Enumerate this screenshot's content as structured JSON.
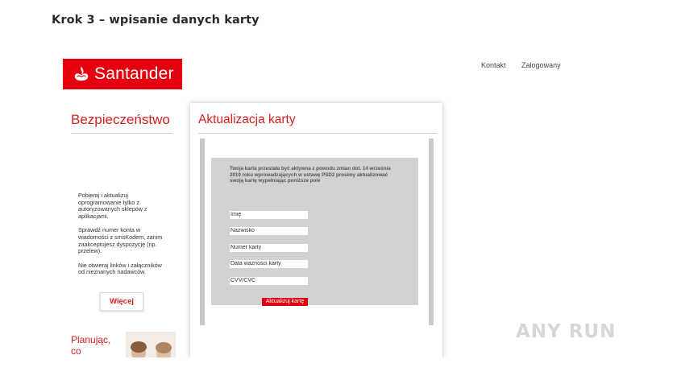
{
  "step_heading": "Krok 3 – wpisanie danych karty",
  "brand": {
    "name": "Santander",
    "color": "#e3000f"
  },
  "top_nav": {
    "contact": "Kontakt",
    "logged_in": "Zalogowany"
  },
  "sidebar": {
    "title": "Bezpieczeństwo",
    "tips": [
      "Pobieraj i aktualizuj oprogramowanie tylko z autoryzowanych sklepów z aplikacjami.",
      "Sprawdź numer konta w wiadomości z smsKodem, zanim zaakceptujesz dyspozycję (np. przelew).",
      "Nie otwieraj linków i załączników od nieznanych nadawców."
    ],
    "more_button": "Więcej",
    "promo_text_line1": "Planując,",
    "promo_text_line2": "co"
  },
  "card_form": {
    "title": "Aktualizacja karty",
    "message": "Twoja karta przestała być aktywna z powodu zmian dot. 14 września 2019 roku wprowadzających w ustawę PSD2 prosimy aktualizować swoją kartę wypełniając poniższe pole",
    "fields": {
      "name": "Imię",
      "surname": "Nazwisko",
      "card_number": "Numer karty",
      "expiry": "Data ważności karty",
      "cvv": "CVV/CVC"
    },
    "submit": "Aktualizuj kartę"
  },
  "watermark": "ANY RUN"
}
